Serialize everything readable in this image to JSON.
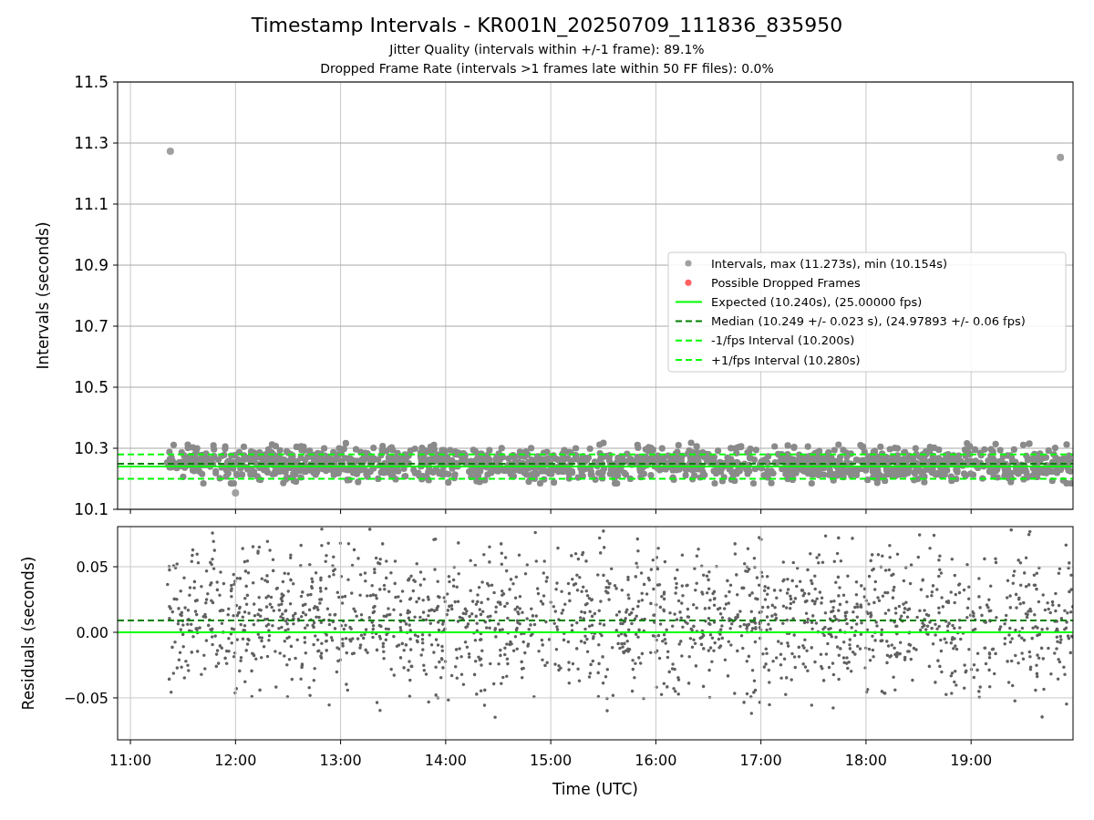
{
  "figure": {
    "title": "Timestamp Intervals - KR001N_20250709_111836_835950",
    "subtitles": [
      "Jitter Quality (intervals within +/-1 frame): 89.1%",
      "Dropped Frame Rate (intervals >1 frames late within 50 FF files): 0.0%"
    ]
  },
  "interval_plot": {
    "chart_data": {
      "type": "scatter",
      "ylabel": "Intervals (seconds)",
      "grid": true,
      "x": [
        11.38,
        12.0,
        19.85
      ],
      "legend": true,
      "series": [
        {
          "name": "Intervals, max (11.273s), min (10.154s)",
          "color": "#a0a0a0",
          "values": [
            11.273,
            10.154,
            11.253
          ]
        },
        {
          "name": "Possible Dropped Frames",
          "color": "#ff6060",
          "values": [
            null,
            null,
            null
          ]
        }
      ],
      "xlim": [
        10.878,
        19.97
      ],
      "ylim": [
        10.1,
        11.5
      ],
      "yticks": [
        {
          "value": 10.1,
          "label": "10.1"
        },
        {
          "value": 10.3,
          "label": "10.3"
        },
        {
          "value": 10.5,
          "label": "10.5"
        },
        {
          "value": 10.7,
          "label": "10.7"
        },
        {
          "value": 10.9,
          "label": "10.9"
        },
        {
          "value": 11.1,
          "label": "11.1"
        },
        {
          "value": 11.3,
          "label": "11.3"
        },
        {
          "value": 11.5,
          "label": "11.5"
        }
      ],
      "ref_lines": [
        {
          "axis": "y",
          "value": 10.24,
          "label": "Expected (10.240s), (25.00000 fps)",
          "color": "#00ff00"
        },
        {
          "axis": "y",
          "value": 10.249,
          "label": "Median (10.249 +/- 0.023 s), (24.97893 +/- 0.06 fps)",
          "color": "#008000"
        },
        {
          "axis": "y",
          "value": 10.2,
          "label": "-1/fps Interval (10.200s)",
          "color": "#00ff00"
        },
        {
          "axis": "y",
          "value": 10.28,
          "label": "+1/fps Interval (10.280s)",
          "color": "#00ff00"
        }
      ]
    }
  },
  "residual_plot": {
    "chart_data": {
      "type": "scatter",
      "xlabel": "Time (UTC)",
      "ylabel": "Residuals (seconds)",
      "grid": true,
      "xlim": [
        10.878,
        19.97
      ],
      "ylim": [
        -0.082,
        0.0806
      ],
      "xticks": [
        {
          "value": 11,
          "label": "11:00"
        },
        {
          "value": 12,
          "label": "12:00"
        },
        {
          "value": 13,
          "label": "13:00"
        },
        {
          "value": 14,
          "label": "14:00"
        },
        {
          "value": 15,
          "label": "15:00"
        },
        {
          "value": 16,
          "label": "16:00"
        },
        {
          "value": 17,
          "label": "17:00"
        },
        {
          "value": 18,
          "label": "18:00"
        },
        {
          "value": 19,
          "label": "19:00"
        }
      ],
      "yticks": [
        {
          "value": -0.05,
          "label": "−0.05"
        },
        {
          "value": 0,
          "label": "0.00"
        },
        {
          "value": 0.05,
          "label": "0.05"
        }
      ],
      "ref_lines": [
        {
          "axis": "y",
          "value": 0,
          "color": "#00ff00"
        },
        {
          "axis": "y",
          "value": 0.009,
          "color": "#008000"
        }
      ]
    }
  }
}
